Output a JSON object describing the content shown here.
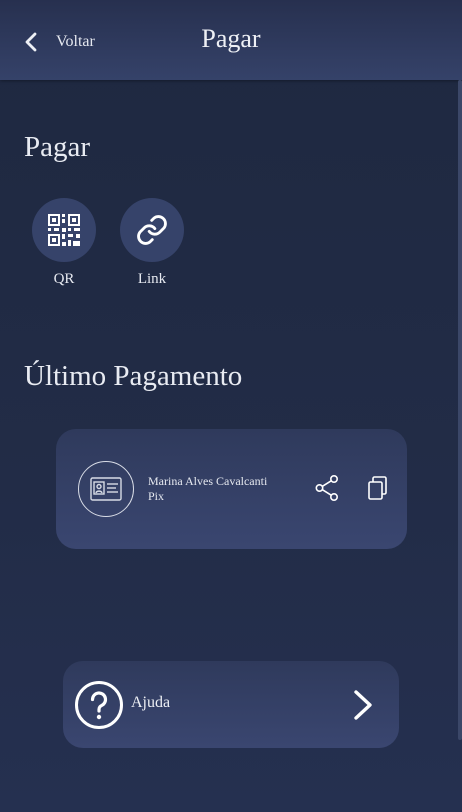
{
  "header": {
    "back_label": "Voltar",
    "title": "Pagar",
    "back_icon": "chevron-left-icon"
  },
  "pay_section": {
    "title": "Pagar",
    "actions": [
      {
        "label": "QR",
        "icon": "qr-code-icon"
      },
      {
        "label": "Link",
        "icon": "link-icon"
      }
    ]
  },
  "last_payment": {
    "title": "Último Pagamento",
    "name": "Marina Alves Cavalcanti",
    "type": "Pix",
    "avatar_icon": "id-card-icon",
    "share_icon": "share-icon",
    "copy_icon": "copy-icon"
  },
  "help": {
    "label": "Ajuda",
    "icon": "help-circle-icon",
    "chevron_icon": "chevron-right-icon"
  },
  "colors": {
    "background": "#1f2940",
    "header": "#354269",
    "card": "#36436a",
    "text": "#e8ebf2"
  }
}
